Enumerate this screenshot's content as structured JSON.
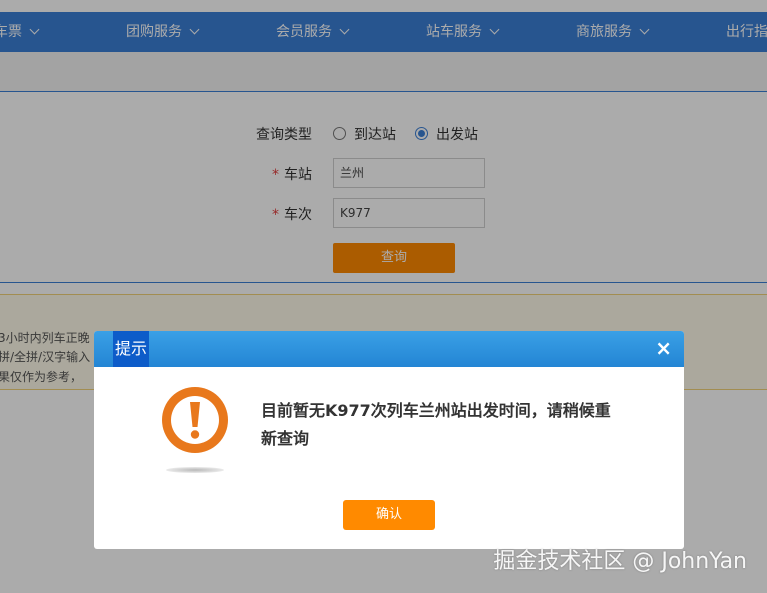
{
  "nav": {
    "items": [
      {
        "label": "车票"
      },
      {
        "label": "团购服务"
      },
      {
        "label": "会员服务"
      },
      {
        "label": "站车服务"
      },
      {
        "label": "商旅服务"
      },
      {
        "label": "出行指"
      }
    ]
  },
  "query": {
    "type_label": "查询类型",
    "type_options": [
      {
        "label": "到达站",
        "selected": false
      },
      {
        "label": "出发站",
        "selected": true
      }
    ],
    "station_label": "车站",
    "station_value": "兰州",
    "train_label": "车次",
    "train_value": "K977",
    "required_mark": "*",
    "submit_label": "查询"
  },
  "notice": {
    "lines": [
      "3小时内列车正晚",
      "拼/全拼/汉字输入",
      "果仅作为参考，"
    ]
  },
  "dialog": {
    "title": "提示",
    "close_glyph": "×",
    "icon": "exclamation-warning-icon",
    "message": "目前暂无K977次列车兰州站出发时间，请稍候重新查询",
    "confirm_label": "确认"
  },
  "watermark": "掘金技术社区 @ JohnYan",
  "colors": {
    "nav_blue": "#3b7fd6",
    "accent_orange": "#ff8a00",
    "dialog_header": "#2385d4",
    "warning_icon": "#e8781c"
  }
}
